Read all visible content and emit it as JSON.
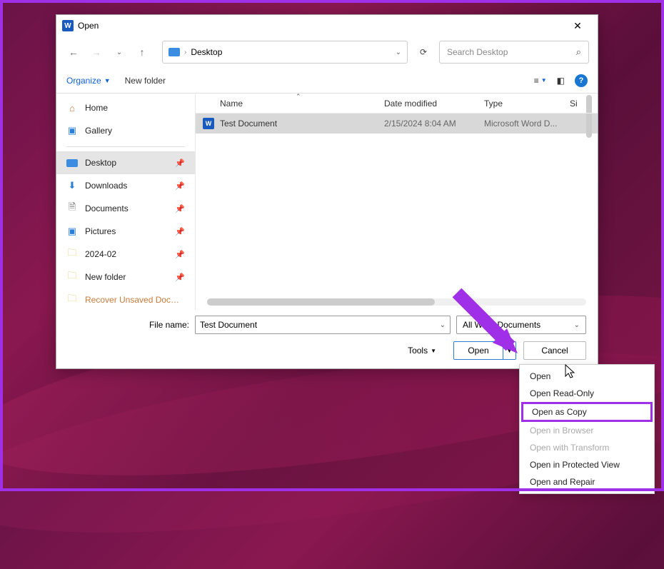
{
  "window": {
    "title": "Open"
  },
  "nav": {
    "location": "Desktop"
  },
  "search": {
    "placeholder": "Search Desktop"
  },
  "toolbar": {
    "organize": "Organize",
    "new_folder": "New folder"
  },
  "sidebar": {
    "items": [
      {
        "label": "Home",
        "icon": "home"
      },
      {
        "label": "Gallery",
        "icon": "gallery"
      },
      {
        "label": "Desktop",
        "icon": "desktop",
        "selected": true,
        "pinned": true
      },
      {
        "label": "Downloads",
        "icon": "download",
        "pinned": true
      },
      {
        "label": "Documents",
        "icon": "document",
        "pinned": true
      },
      {
        "label": "Pictures",
        "icon": "picture",
        "pinned": true
      },
      {
        "label": "2024-02",
        "icon": "folder",
        "pinned": true
      },
      {
        "label": "New folder",
        "icon": "folder",
        "pinned": true
      },
      {
        "label": "Recover Unsaved Doc…",
        "icon": "folder"
      }
    ]
  },
  "columns": {
    "name": "Name",
    "date": "Date modified",
    "type": "Type",
    "size": "Si"
  },
  "files": [
    {
      "name": "Test Document",
      "date": "2/15/2024 8:04 AM",
      "type": "Microsoft Word D...",
      "selected": true
    }
  ],
  "filename": {
    "label": "File name:",
    "value": "Test Document"
  },
  "filter": {
    "label": "All Word Documents"
  },
  "buttons": {
    "tools": "Tools",
    "open": "Open",
    "cancel": "Cancel"
  },
  "menu": {
    "items": [
      {
        "label": "Open"
      },
      {
        "label": "Open Read-Only"
      },
      {
        "label": "Open as Copy",
        "highlighted": true
      },
      {
        "label": "Open in Browser",
        "disabled": true
      },
      {
        "label": "Open with Transform",
        "disabled": true
      },
      {
        "label": "Open in Protected View"
      },
      {
        "label": "Open and Repair"
      }
    ]
  }
}
